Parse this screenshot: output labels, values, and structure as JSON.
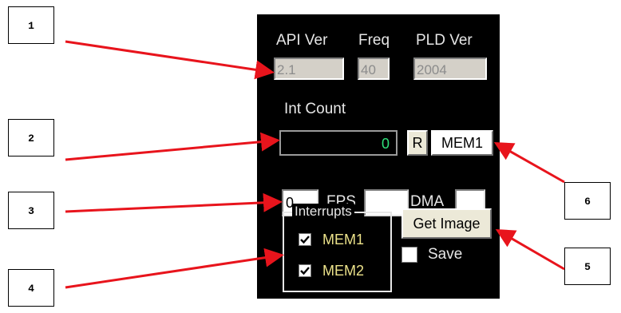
{
  "callouts": [
    "1",
    "2",
    "3",
    "4",
    "5",
    "6"
  ],
  "version_labels": {
    "api": "API Ver",
    "freq": "Freq",
    "pld": "PLD Ver"
  },
  "version_values": {
    "api": "2.1",
    "freq": "40",
    "pld": "2004"
  },
  "int_count": {
    "label": "Int Count",
    "value": "0"
  },
  "buttons": {
    "reset": "R",
    "mem": "MEM1",
    "get_image": "Get Image"
  },
  "fps": {
    "value": "0",
    "label": "FPS",
    "field_value": ""
  },
  "dma": {
    "label": "DMA",
    "value": ""
  },
  "interrupts": {
    "title": "Interrupts",
    "items": [
      {
        "label": "MEM1",
        "checked": true
      },
      {
        "label": "MEM2",
        "checked": true
      }
    ]
  },
  "save": {
    "label": "Save",
    "checked": false
  },
  "colors": {
    "arrow": "#e8141c",
    "panel": "#000000",
    "counter_text": "#2ee07a",
    "check_label": "#ece28a"
  }
}
